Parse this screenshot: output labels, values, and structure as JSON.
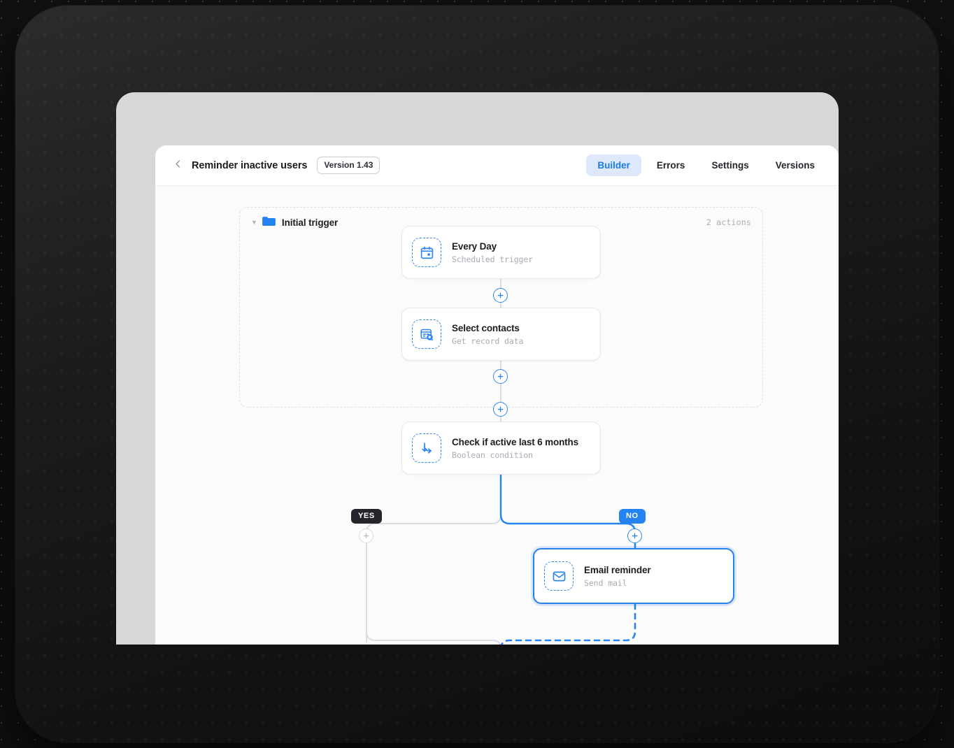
{
  "window": {
    "header": {
      "back_icon": "chevron-left-icon",
      "title": "Reminder inactive users",
      "version_badge": "Version 1.43",
      "tabs": [
        {
          "label": "Builder",
          "active": true
        },
        {
          "label": "Errors",
          "active": false
        },
        {
          "label": "Settings",
          "active": false
        },
        {
          "label": "Versions",
          "active": false
        }
      ]
    }
  },
  "canvas": {
    "group": {
      "collapse_icon": "chevron-down-icon",
      "folder_icon": "folder-icon",
      "title": "Initial trigger",
      "actions_count": "2 actions"
    },
    "nodes": [
      {
        "id": "every-day",
        "icon": "calendar-icon",
        "title": "Every Day",
        "subtitle": "Scheduled trigger",
        "selected": false
      },
      {
        "id": "select-contacts",
        "icon": "record-search-icon",
        "title": "Select contacts",
        "subtitle": "Get record data",
        "selected": false
      },
      {
        "id": "check-active",
        "icon": "branch-arrow-icon",
        "title": "Check if active last 6 months",
        "subtitle": "Boolean condition",
        "selected": false
      },
      {
        "id": "email-reminder",
        "icon": "envelope-icon",
        "title": "Email reminder",
        "subtitle": "Send mail",
        "selected": true
      }
    ],
    "branches": [
      {
        "id": "yes",
        "label": "YES",
        "color": "#24262b",
        "active": false
      },
      {
        "id": "no",
        "label": "NO",
        "color": "#2483f0",
        "active": true
      }
    ],
    "add_buttons": [
      {
        "id": "plus-1",
        "icon": "plus-icon",
        "active": true
      },
      {
        "id": "plus-2",
        "icon": "plus-icon",
        "active": true
      },
      {
        "id": "plus-3",
        "icon": "plus-icon",
        "active": true
      },
      {
        "id": "plus-yes",
        "icon": "plus-icon",
        "active": false
      },
      {
        "id": "plus-no",
        "icon": "plus-icon",
        "active": true
      }
    ]
  },
  "colors": {
    "accent": "#2483f0",
    "accent_soft": "#dde9fb",
    "text": "#1b1d21",
    "muted": "#a7acb4",
    "wire": "#d9dce1",
    "canvas": "#fbfbfc",
    "panel": "#d5d7d9",
    "backdrop": "#111113",
    "badge_dark": "#24262b"
  }
}
